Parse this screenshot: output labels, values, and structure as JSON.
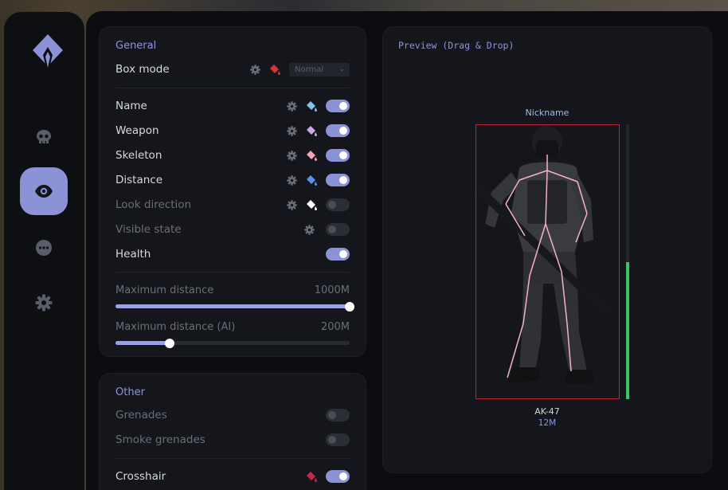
{
  "sidebar": {
    "items": [
      {
        "icon": "skull-icon",
        "active": false
      },
      {
        "icon": "eye-icon",
        "active": true
      },
      {
        "icon": "more-icon",
        "active": false
      },
      {
        "icon": "gear-icon",
        "active": false
      }
    ]
  },
  "general": {
    "title": "General",
    "box_mode": {
      "label": "Box mode",
      "select_value": "Normal",
      "color": "#d5323e"
    },
    "rows": [
      {
        "label": "Name",
        "enabled": true,
        "gear": true,
        "color": "#7ec3f2",
        "dim": false
      },
      {
        "label": "Weapon",
        "enabled": true,
        "gear": true,
        "color": "#c9a8f0",
        "dim": false
      },
      {
        "label": "Skeleton",
        "enabled": true,
        "gear": true,
        "color": "#f3a3b5",
        "dim": false
      },
      {
        "label": "Distance",
        "enabled": true,
        "gear": true,
        "color": "#5c8ff0",
        "dim": false
      },
      {
        "label": "Look direction",
        "enabled": false,
        "gear": true,
        "color": "#ffffff",
        "dim": true
      },
      {
        "label": "Visible state",
        "enabled": false,
        "gear": true,
        "color": null,
        "dim": true
      },
      {
        "label": "Health",
        "enabled": true,
        "gear": false,
        "color": null,
        "dim": false
      }
    ],
    "max_distance": {
      "label": "Maximum distance",
      "value_text": "1000M",
      "fraction": 1.0
    },
    "max_distance_ai": {
      "label": "Maximum distance (AI)",
      "value_text": "200M",
      "fraction": 0.23
    }
  },
  "other": {
    "title": "Other",
    "rows": [
      {
        "label": "Grenades",
        "enabled": false,
        "dim": true
      },
      {
        "label": "Smoke grenades",
        "enabled": false,
        "dim": true
      }
    ],
    "crosshair": {
      "label": "Crosshair",
      "enabled": true,
      "color": "#c8264a"
    }
  },
  "preview": {
    "title": "Preview (Drag & Drop)",
    "nickname": "Nickname",
    "weapon": "AK-47",
    "distance": "12M",
    "health_fraction": 0.5,
    "box_color": "#c0242f",
    "health_color": "#3dc45f"
  }
}
